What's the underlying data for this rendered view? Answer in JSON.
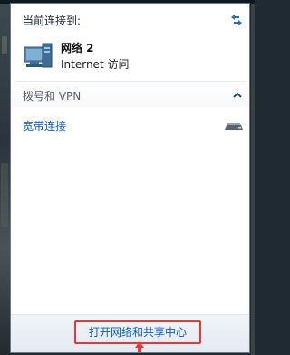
{
  "flyout": {
    "header_label": "当前连接到:",
    "network": {
      "name": "网络  2",
      "access": "Internet 访问",
      "icon": "network-computer-icon"
    },
    "section": {
      "title": "拨号和 VPN",
      "icon": "chevron-up-icon"
    },
    "connections": [
      {
        "label": "宽带连接",
        "icon": "modem-icon"
      }
    ],
    "footer": {
      "link_label": "打开网络和共享中心"
    },
    "colors": {
      "link": "#0a5fc0",
      "highlight": "#e23a3a"
    }
  }
}
